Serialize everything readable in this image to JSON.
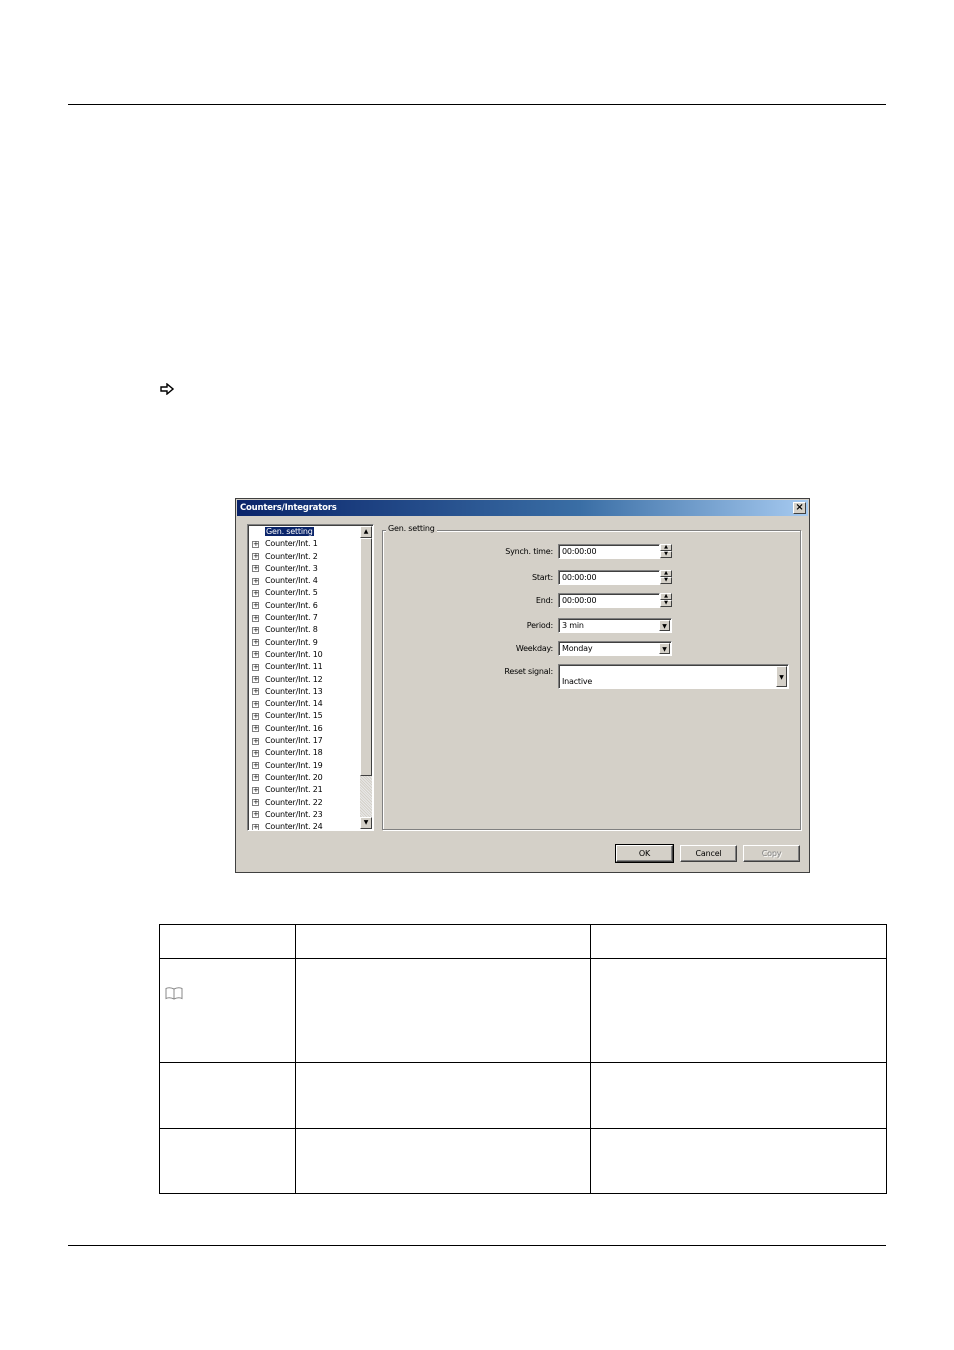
{
  "dialog": {
    "title": "Counters/Integrators",
    "close_symbol": "×",
    "tree_items": [
      "Gen. setting",
      "Counter/Int. 1",
      "Counter/Int. 2",
      "Counter/Int. 3",
      "Counter/Int. 4",
      "Counter/Int. 5",
      "Counter/Int. 6",
      "Counter/Int. 7",
      "Counter/Int. 8",
      "Counter/Int. 9",
      "Counter/Int. 10",
      "Counter/Int. 11",
      "Counter/Int. 12",
      "Counter/Int. 13",
      "Counter/Int. 14",
      "Counter/Int. 15",
      "Counter/Int. 16",
      "Counter/Int. 17",
      "Counter/Int. 18",
      "Counter/Int. 19",
      "Counter/Int. 20",
      "Counter/Int. 21",
      "Counter/Int. 22",
      "Counter/Int. 23",
      "Counter/Int. 24"
    ],
    "selected_item": "Gen. setting",
    "group_title": "Gen. setting",
    "fields": {
      "synch_time": {
        "label": "Synch. time:",
        "value": "00:00:00"
      },
      "start": {
        "label": "Start:",
        "value": "00:00:00"
      },
      "end": {
        "label": "End:",
        "value": "00:00:00"
      },
      "period": {
        "label": "Period:",
        "value": "3 min"
      },
      "weekday": {
        "label": "Weekday:",
        "value": "Monday"
      },
      "reset_signal": {
        "label": "Reset signal:",
        "value": "Inactive"
      }
    },
    "buttons": {
      "ok": "OK",
      "cancel": "Cancel",
      "copy": "Copy"
    }
  }
}
